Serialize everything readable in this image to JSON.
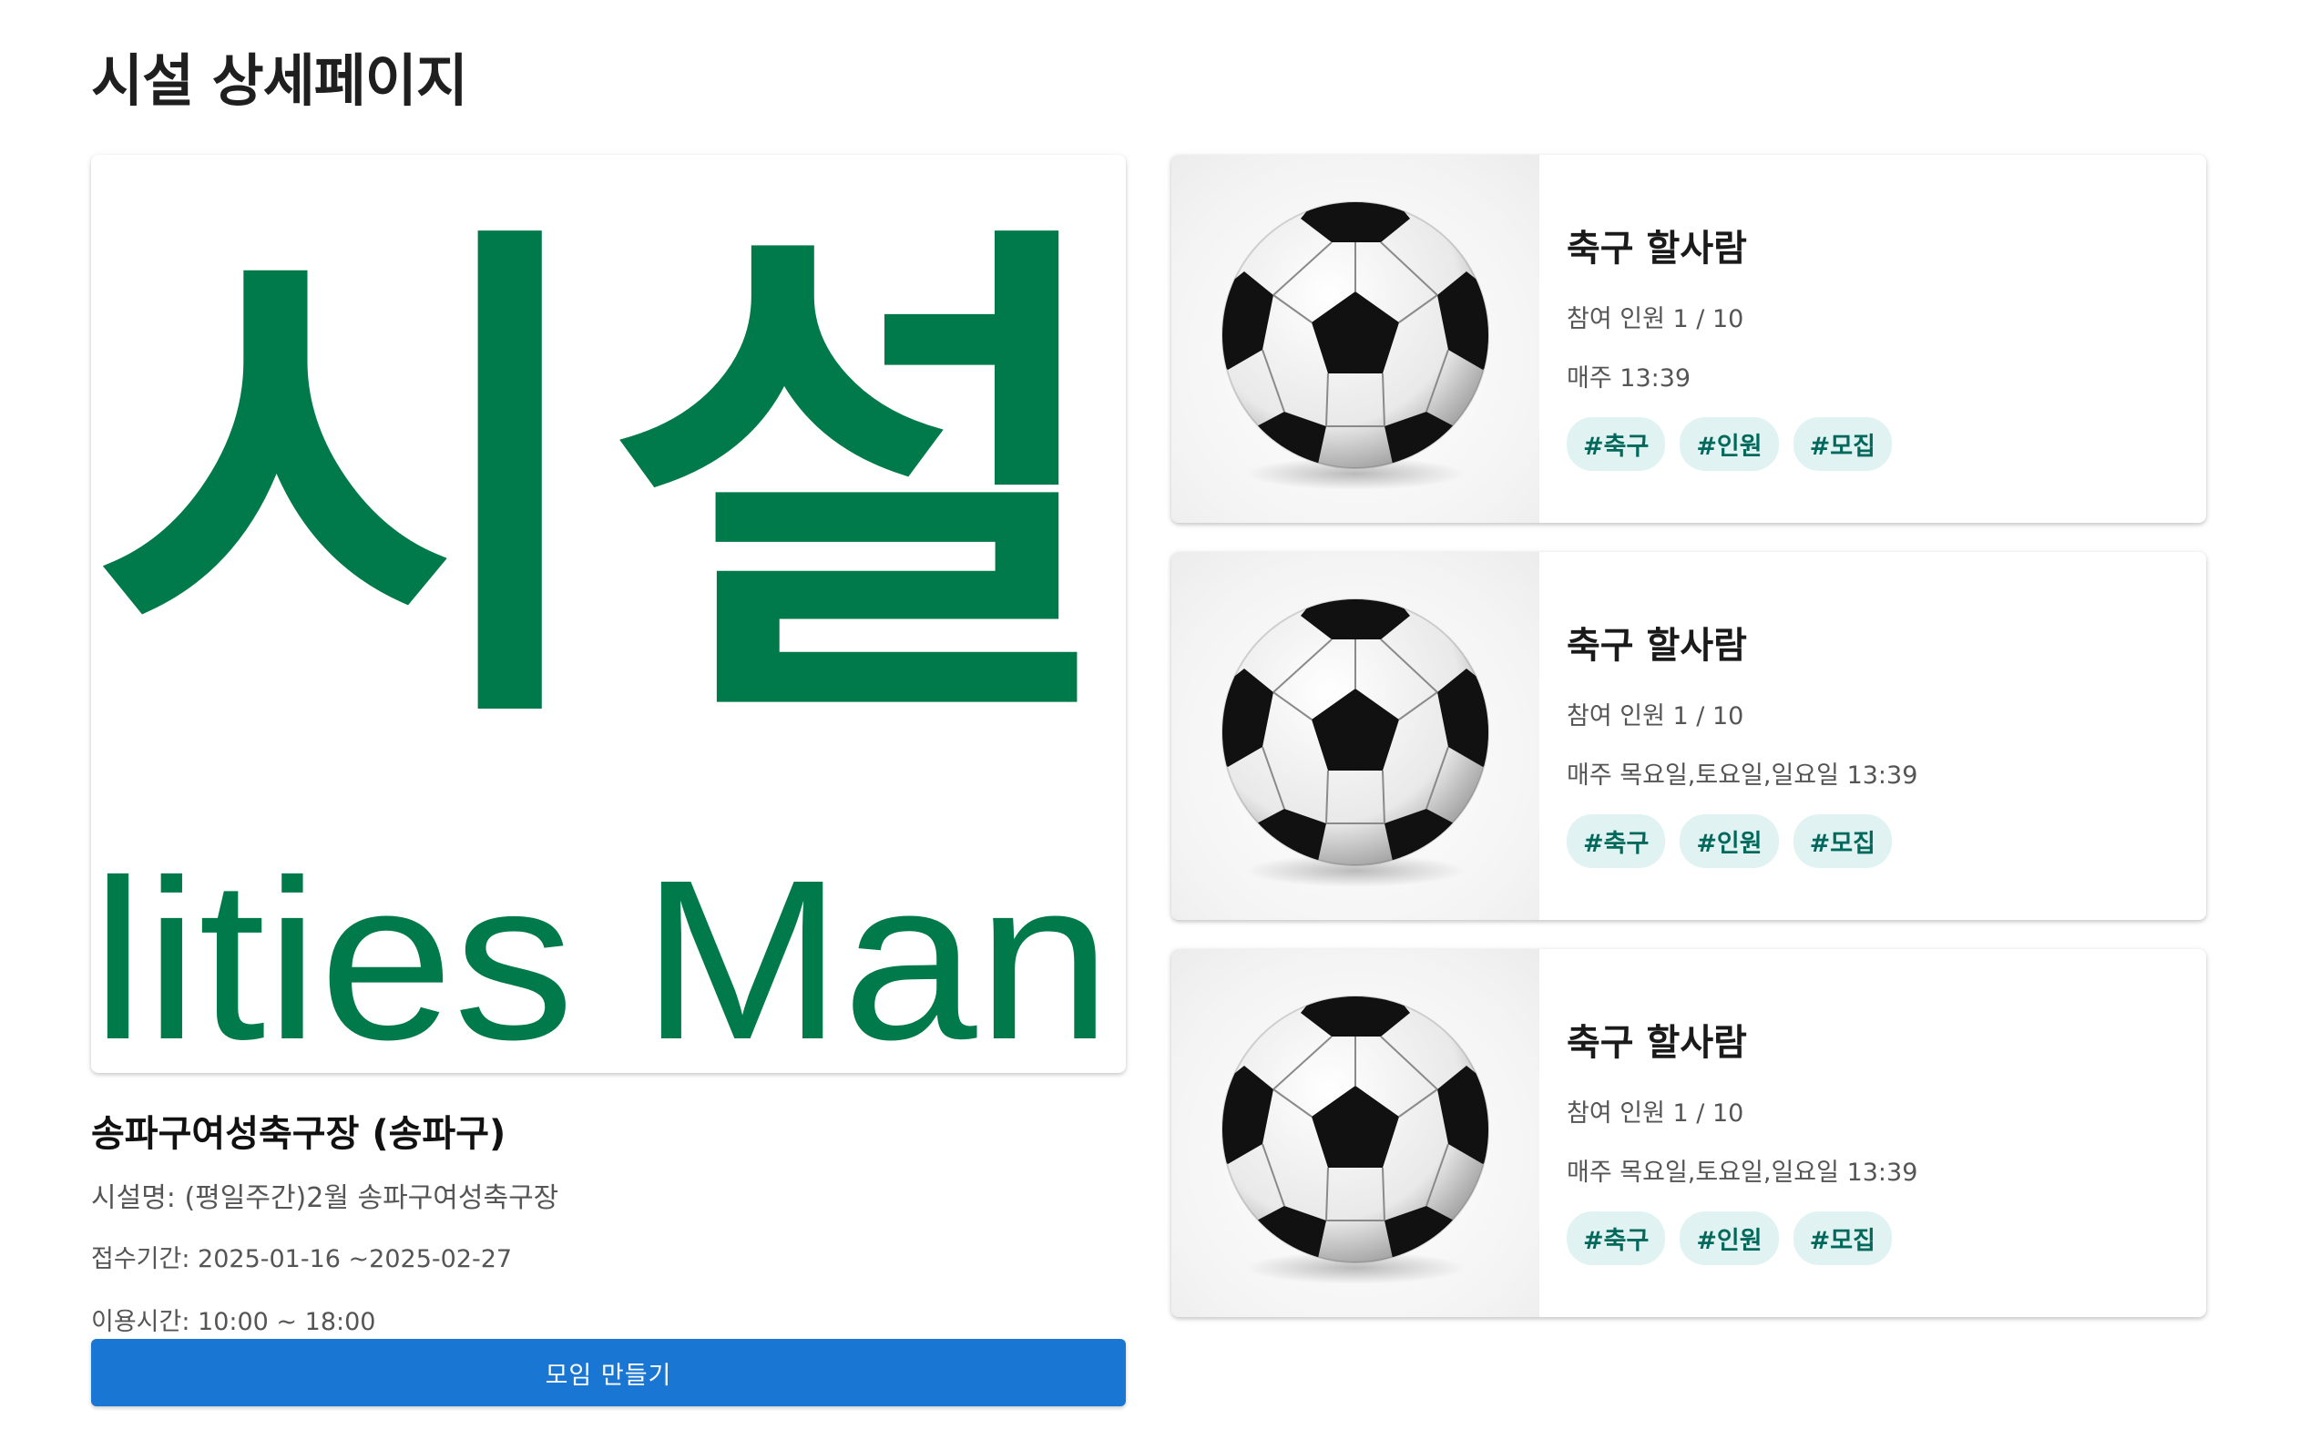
{
  "page": {
    "title": "시설 상세페이지"
  },
  "facility": {
    "image_alt": "시설 관리 로고",
    "logo_text_top": "시설",
    "logo_text_bottom": "lities Man",
    "logo_color": "#007a4a",
    "name": "송파구여성축구장 (송파구)",
    "facility_name": "시설명: (평일주간)2월 송파구여성축구장",
    "reception_period": "접수기간: 2025-01-16 ~2025-02-27",
    "usage_time": "이용시간: 10:00 ~ 18:00"
  },
  "create_button": {
    "label": "모임 만들기",
    "color": "#1976d2"
  },
  "meetings": [
    {
      "image": "soccer-ball",
      "title": "축구 할사람",
      "participants": "참여 인원 1 / 10",
      "schedule": "매주 13:39",
      "tags": [
        "#축구",
        "#인원",
        "#모집"
      ]
    },
    {
      "image": "soccer-ball",
      "title": "축구 할사람",
      "participants": "참여 인원 1 / 10",
      "schedule": "매주 목요일,토요일,일요일 13:39",
      "tags": [
        "#축구",
        "#인원",
        "#모집"
      ]
    },
    {
      "image": "soccer-ball",
      "title": "축구 할사람",
      "participants": "참여 인원 1 / 10",
      "schedule": "매주 목요일,토요일,일요일 13:39",
      "tags": [
        "#축구",
        "#인원",
        "#모집"
      ]
    }
  ],
  "colors": {
    "tag_bg": "#e0f2f1",
    "tag_text": "#00695c"
  }
}
